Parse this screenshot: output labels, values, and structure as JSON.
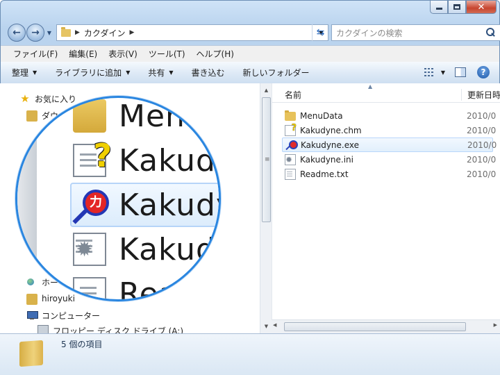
{
  "window": {
    "caption_min_label": "",
    "caption_max_label": "",
    "caption_close_label": "✕"
  },
  "address": {
    "path": "カクダイン",
    "search_placeholder": "カクダインの検索"
  },
  "menu": [
    "ファイル(F)",
    "編集(E)",
    "表示(V)",
    "ツール(T)",
    "ヘルプ(H)"
  ],
  "commands": {
    "organize": "整理",
    "add_to_library": "ライブラリに追加",
    "share": "共有",
    "burn": "書き込む",
    "new_folder": "新しいフォルダー"
  },
  "columns": {
    "name": "名前",
    "date": "更新日時"
  },
  "files": [
    {
      "name": "MenuData",
      "date": "2010/0",
      "icon": "folder-icon"
    },
    {
      "name": "Kakudyne.chm",
      "date": "2010/0",
      "icon": "help-file-icon"
    },
    {
      "name": "Kakudyne.exe",
      "date": "2010/0",
      "icon": "app-icon",
      "selected": true
    },
    {
      "name": "Kakudyne.ini",
      "date": "2010/0",
      "icon": "settings-file-icon"
    },
    {
      "name": "Readme.txt",
      "date": "2010/0",
      "icon": "text-file-icon"
    }
  ],
  "nav": {
    "favorites": "お気に入り",
    "downloads": "ダウ",
    "homegroup": "ホー",
    "user": "hiroyuki",
    "computer": "コンピューター",
    "floppy": "フロッピー ディスク ドライブ (A:)"
  },
  "magnifier": {
    "row1": "Menu",
    "row2": "Kakudyne",
    "row3": "Kakudyn",
    "row4": "Kakudy",
    "row5": "Rea"
  },
  "details": {
    "item_count": "5 個の項目"
  }
}
